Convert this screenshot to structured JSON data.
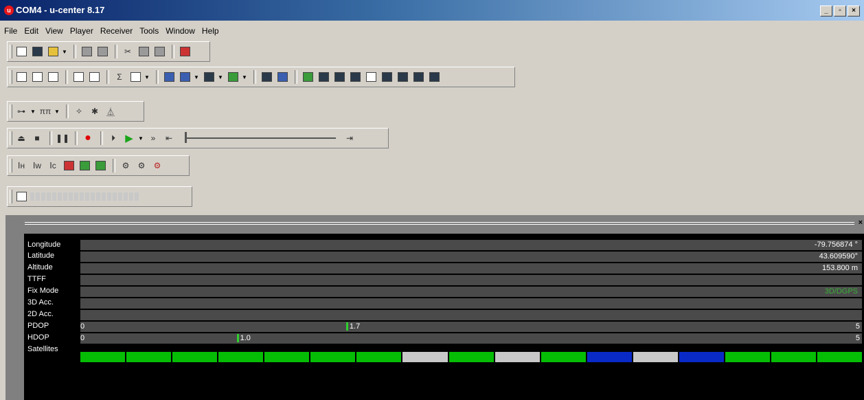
{
  "window": {
    "title": "COM4 - u-center 8.17",
    "icon_label": "u",
    "buttons": [
      "_",
      "▫",
      "×"
    ]
  },
  "menu": [
    "File",
    "Edit",
    "View",
    "Player",
    "Receiver",
    "Tools",
    "Window",
    "Help"
  ],
  "toolbars": {
    "standard": [
      "new-icon",
      "save-icon",
      "open-icon",
      "print-icon",
      "print-preview-icon",
      "cut-icon",
      "copy-icon",
      "paste-icon",
      "stop-icon"
    ],
    "views": [
      "docs-icon",
      "docs-icon",
      "docs-icon",
      "view-icon",
      "view-icon",
      "sum-icon",
      "table-icon",
      "globe-icon",
      "chart-icon",
      "chart-icon",
      "chart-icon",
      "panel-icon",
      "panel-icon",
      "panel-icon",
      "panel-icon",
      "panel-icon",
      "panel-icon",
      "panel-icon",
      "panel-icon",
      "panel-icon",
      "panel-icon",
      "panel-icon"
    ],
    "connection": [
      "connection-icon",
      "baudrate-icon",
      "wizard-icon",
      "debug-icon",
      "antenna-icon"
    ],
    "player": [
      "eject-icon",
      "stop-icon",
      "pause-icon",
      "record-icon",
      "step-icon",
      "play-icon",
      "fast-forward-icon",
      "rewind-icon",
      "end-icon"
    ],
    "receiver": [
      "reset-hot-icon",
      "reset-warm-icon",
      "reset-cold-icon",
      "config-icon",
      "messages-icon",
      "messages-icon",
      "gear-icon",
      "gear-icon",
      "gear-icon"
    ]
  },
  "data_view": {
    "rows": [
      {
        "label": "Longitude",
        "value": "-79.756874 °"
      },
      {
        "label": "Latitude",
        "value": "43.609590°"
      },
      {
        "label": "Altitude",
        "value": "153.800 m"
      },
      {
        "label": "TTFF",
        "value": ""
      },
      {
        "label": "Fix Mode",
        "value": "3D/DGPS"
      },
      {
        "label": "3D Acc.",
        "value": ""
      },
      {
        "label": "2D Acc.",
        "value": ""
      }
    ],
    "pdop": {
      "label": "PDOP",
      "min": "0",
      "max": "5",
      "value": "1.7"
    },
    "hdop": {
      "label": "HDOP",
      "min": "0",
      "max": "5",
      "value": "1.0"
    },
    "satellites": {
      "label": "Satellites",
      "colors": [
        "#06bd06",
        "#06bd06",
        "#06bd06",
        "#06bd06",
        "#06bd06",
        "#06bd06",
        "#06bd06",
        "#c8c8c8",
        "#06bd06",
        "#c8c8c8",
        "#06bd06",
        "#0a2ac8",
        "#c8c8c8",
        "#0a2ac8",
        "#06bd06",
        "#06bd06",
        "#06bd06"
      ]
    }
  },
  "colors": {
    "fix_mode": "#3ab03a",
    "dop_marker": "#2fd02f"
  }
}
